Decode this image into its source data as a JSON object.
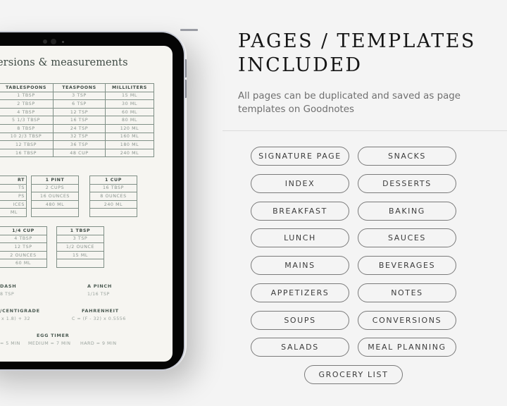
{
  "tablet": {
    "page_title": "ersions & measurements",
    "main_table": {
      "headers": [
        "TABLESPOONS",
        "TEASPOONS",
        "MILLILITERS"
      ],
      "rows": [
        [
          "1 TBSP",
          "3 TSP",
          "15 ML"
        ],
        [
          "2 TBSP",
          "6 TSP",
          "30 ML"
        ],
        [
          "4 TBSP",
          "12 TSP",
          "60 ML"
        ],
        [
          "5 1/3 TBSP",
          "16 TSP",
          "80 ML"
        ],
        [
          "8 TBSP",
          "24 TSP",
          "120 ML"
        ],
        [
          "10 2/3 TBSP",
          "32 TSP",
          "160 ML"
        ],
        [
          "12 TBSP",
          "36 TSP",
          "180 ML"
        ],
        [
          "16 TBSP",
          "48 CUP",
          "240 ML"
        ]
      ]
    },
    "mini_tables": [
      {
        "header": "RT",
        "rows": [
          "TS",
          "PS",
          "ICES",
          "ML"
        ]
      },
      {
        "header": "1 PINT",
        "rows": [
          "2 CUPS",
          "16 OUNCES",
          "480 ML",
          ""
        ]
      },
      {
        "header": "1 CUP",
        "rows": [
          "16 TBSP",
          "8 OUNCES",
          "240 ML",
          ""
        ]
      },
      {
        "header": "1/4 CUP",
        "rows": [
          "4 TBSP",
          "12 TSP",
          "2 OUNCES",
          "60 ML"
        ]
      },
      {
        "header": "1 TBSP",
        "rows": [
          "3 TSP",
          "1/2 OUNCE",
          "15 ML",
          ""
        ]
      }
    ],
    "info": {
      "dash_label": "DASH",
      "dash_value": "8 TSP",
      "pinch_label": "A PINCH",
      "pinch_value": "1/16 TSP",
      "celsius_label": "/CENTIGRADE",
      "celsius_value": "x 1.8) + 32",
      "fahrenheit_label": "FAHRENHEIT",
      "fahrenheit_value": "C = (F - 32) x 0.5556",
      "egg_label": "EGG TIMER",
      "egg_soft": "= 5 MIN",
      "egg_medium": "MEDIUM = 7 MIN",
      "egg_hard": "HARD = 9 MIN"
    }
  },
  "panel": {
    "heading_line1": "PAGES / TEMPLATES",
    "heading_line2": "INCLUDED",
    "subtext": "All pages can be duplicated and saved as page templates on Goodnotes",
    "templates_left": [
      "SIGNATURE PAGE",
      "INDEX",
      "BREAKFAST",
      "LUNCH",
      "MAINS",
      "APPETIZERS",
      "SOUPS",
      "SALADS"
    ],
    "templates_right": [
      "SNACKS",
      "DESSERTS",
      "BAKING",
      "SAUCES",
      "BEVERAGES",
      "NOTES",
      "CONVERSIONS",
      "MEAL PLANNING"
    ],
    "template_center": "GROCERY LIST"
  }
}
